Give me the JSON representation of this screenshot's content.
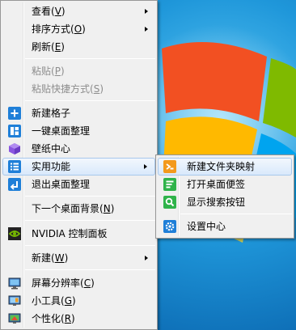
{
  "main_menu": {
    "items": [
      {
        "label": "查看",
        "accel": "V",
        "submenu": true
      },
      {
        "label": "排序方式",
        "accel": "O",
        "submenu": true
      },
      {
        "label": "刷新",
        "accel": "E"
      },
      {
        "label": "粘贴",
        "accel": "P",
        "disabled": true
      },
      {
        "label": "粘贴快捷方式",
        "accel": "S",
        "disabled": true
      },
      {
        "label": "新建格子",
        "icon": "plus-icon"
      },
      {
        "label": "一键桌面整理",
        "icon": "layout-icon"
      },
      {
        "label": "壁纸中心",
        "icon": "cube-icon"
      },
      {
        "label": "实用功能",
        "icon": "list-icon",
        "submenu": true,
        "selected": true
      },
      {
        "label": "退出桌面整理",
        "icon": "exit-icon"
      },
      {
        "label": "下一个桌面背景",
        "accel": "N"
      },
      {
        "label": "NVIDIA 控制面板",
        "icon": "nvidia-icon"
      },
      {
        "label": "新建",
        "accel": "W",
        "submenu": true
      },
      {
        "label": "屏幕分辨率",
        "accel": "C",
        "icon": "monitor-icon"
      },
      {
        "label": "小工具",
        "accel": "G",
        "icon": "gadgets-icon"
      },
      {
        "label": "个性化",
        "accel": "R",
        "icon": "personalize-icon"
      }
    ]
  },
  "sub_menu": {
    "items": [
      {
        "label": "新建文件夹映射",
        "icon": "folder-map-icon",
        "selected": true
      },
      {
        "label": "打开桌面便签",
        "icon": "note-icon"
      },
      {
        "label": "显示搜索按钮",
        "icon": "search-icon"
      },
      {
        "label": "设置中心",
        "icon": "gear-icon"
      }
    ]
  },
  "colors": {
    "menu_bg": "#f0f0f0",
    "highlight_border": "#a8c8ec",
    "icon_blue": "#1f7fd8",
    "icon_purple": "#8a56e0",
    "icon_green": "#2fb34a",
    "icon_orange": "#f39a1d",
    "nvidia_green": "#76b900"
  }
}
